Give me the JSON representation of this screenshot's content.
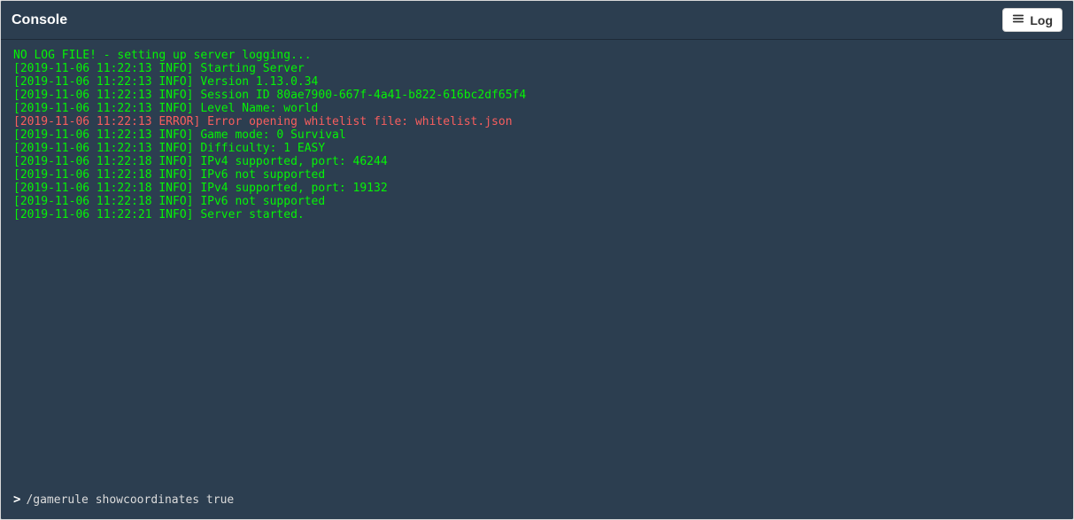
{
  "header": {
    "title": "Console",
    "log_button_label": "Log"
  },
  "console": {
    "lines": [
      {
        "text": "NO LOG FILE! - setting up server logging...",
        "level": "info"
      },
      {
        "text": "[2019-11-06 11:22:13 INFO] Starting Server",
        "level": "info"
      },
      {
        "text": "[2019-11-06 11:22:13 INFO] Version 1.13.0.34",
        "level": "info"
      },
      {
        "text": "[2019-11-06 11:22:13 INFO] Session ID 80ae7900-667f-4a41-b822-616bc2df65f4",
        "level": "info"
      },
      {
        "text": "[2019-11-06 11:22:13 INFO] Level Name: world",
        "level": "info"
      },
      {
        "text": "[2019-11-06 11:22:13 ERROR] Error opening whitelist file: whitelist.json",
        "level": "error"
      },
      {
        "text": "[2019-11-06 11:22:13 INFO] Game mode: 0 Survival",
        "level": "info"
      },
      {
        "text": "[2019-11-06 11:22:13 INFO] Difficulty: 1 EASY",
        "level": "info"
      },
      {
        "text": "[2019-11-06 11:22:18 INFO] IPv4 supported, port: 46244",
        "level": "info"
      },
      {
        "text": "[2019-11-06 11:22:18 INFO] IPv6 not supported",
        "level": "info"
      },
      {
        "text": "[2019-11-06 11:22:18 INFO] IPv4 supported, port: 19132",
        "level": "info"
      },
      {
        "text": "[2019-11-06 11:22:18 INFO] IPv6 not supported",
        "level": "info"
      },
      {
        "text": "[2019-11-06 11:22:21 INFO] Server started.",
        "level": "info"
      }
    ]
  },
  "input": {
    "prompt_symbol": ">",
    "value": "/gamerule showcoordinates true"
  }
}
